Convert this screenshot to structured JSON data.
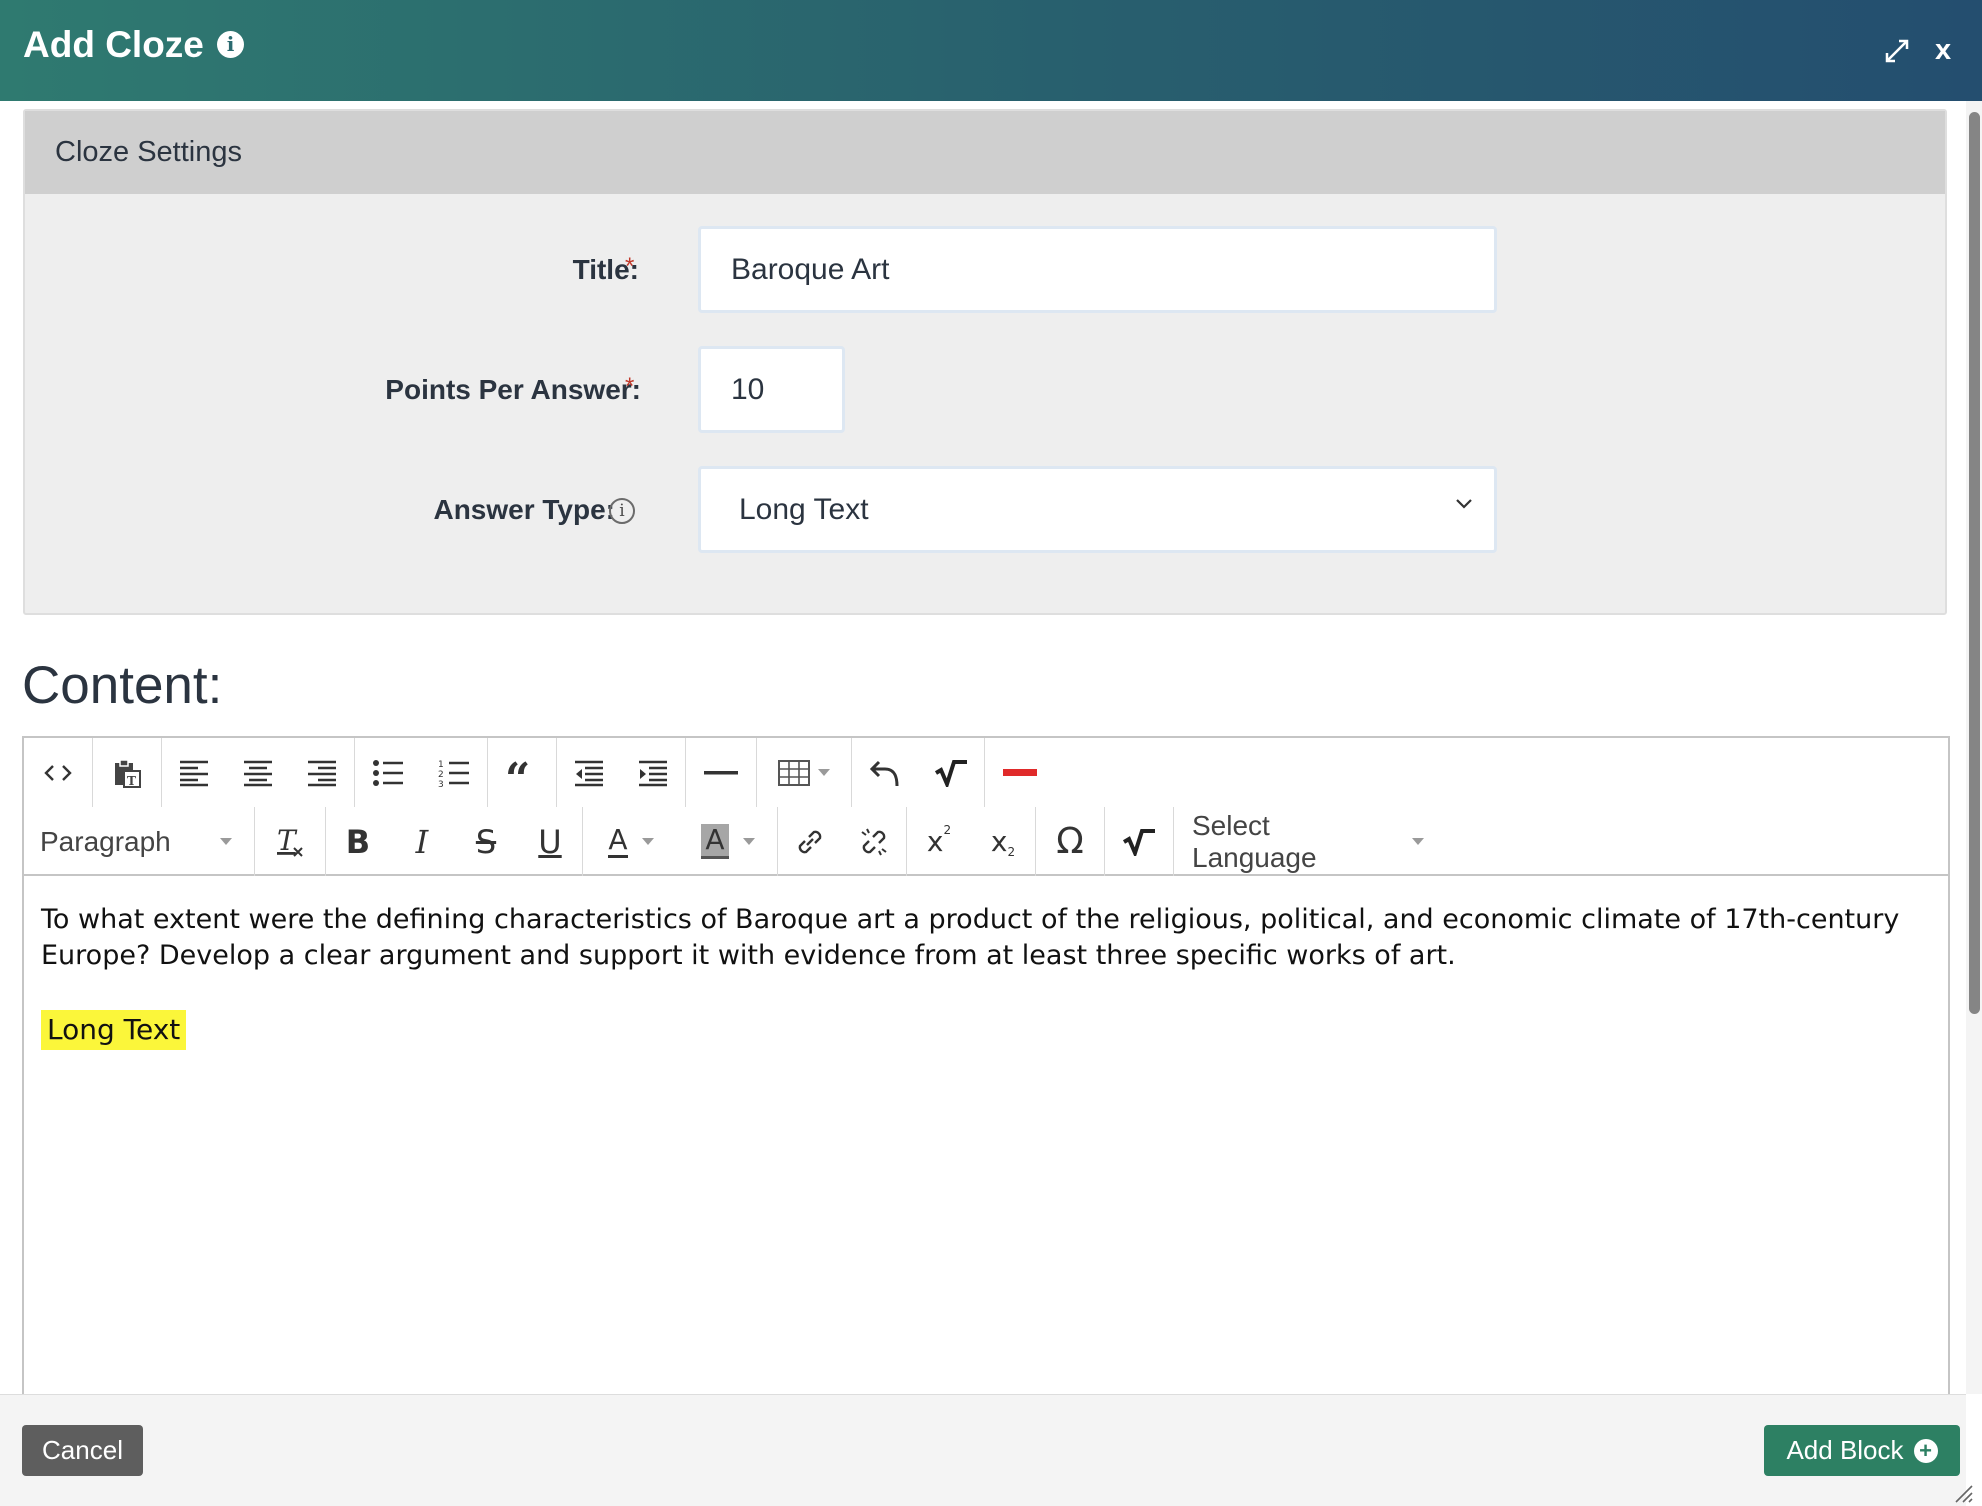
{
  "dialog": {
    "title": "Add Cloze",
    "info_icon": "i",
    "expand_icon": "expand-icon",
    "close_label": "x"
  },
  "settings": {
    "header": "Cloze Settings",
    "title_label": "Title:",
    "title_value": "Baroque Art",
    "points_label": "Points Per Answer:",
    "points_value": "10",
    "answer_type_label": "Answer Type:",
    "answer_type_value": "Long Text",
    "required_mark": "*",
    "info_icon": "i"
  },
  "content": {
    "heading": "Content:",
    "toolbar": {
      "block_format": "Paragraph",
      "language": "Select Language",
      "superscript": "x",
      "subscript": "x",
      "bold": "B",
      "italic": "I",
      "strike": "S",
      "underline": "U",
      "font_color": "A",
      "bg_color": "A",
      "omega": "Ω"
    },
    "text": "To what extent were the defining characteristics of Baroque art a product of the religious, political, and economic climate of 17th-century Europe? Develop a clear argument and support it with evidence from at least three specific works of art.",
    "answer_placeholder": "Long Text"
  },
  "footer": {
    "cancel_label": "Cancel",
    "add_label": "Add Block"
  },
  "colors": {
    "header_gradient_start": "#2f7a70",
    "header_gradient_end": "#244e6f",
    "add_button": "#2d8063",
    "cancel_button": "#5e5e5e",
    "highlight": "#fbf63a",
    "required": "#c0392b"
  }
}
